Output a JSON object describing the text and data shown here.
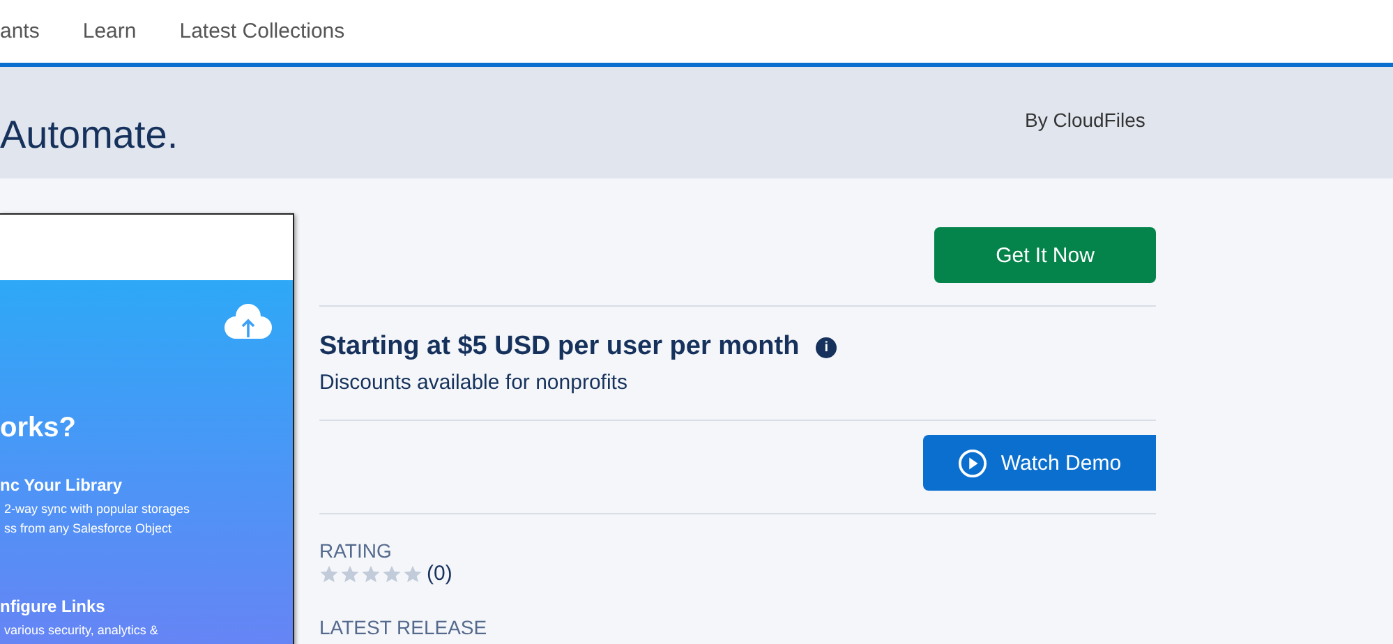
{
  "nav": {
    "items": [
      {
        "label": "ants"
      },
      {
        "label": "Learn"
      },
      {
        "label": "Latest Collections"
      }
    ]
  },
  "header": {
    "title": "Automate.",
    "publisher": "By CloudFiles"
  },
  "screenshot": {
    "heading": "orks?",
    "sections": [
      {
        "title": "nc Your Library",
        "lines": [
          "2-way sync with popular storages",
          "ss from any Salesforce Object"
        ]
      },
      {
        "title": "nfigure Links",
        "lines": [
          "various security, analytics &"
        ]
      }
    ]
  },
  "get_button": "Get It Now",
  "pricing": {
    "price": "Starting at $5 USD per user per month",
    "info_icon": "i",
    "note": "Discounts available for nonprofits"
  },
  "demo_button": "Watch Demo",
  "rating": {
    "label": "RATING",
    "stars": 0,
    "count": "(0)"
  },
  "next_label": "LATEST RELEASE"
}
